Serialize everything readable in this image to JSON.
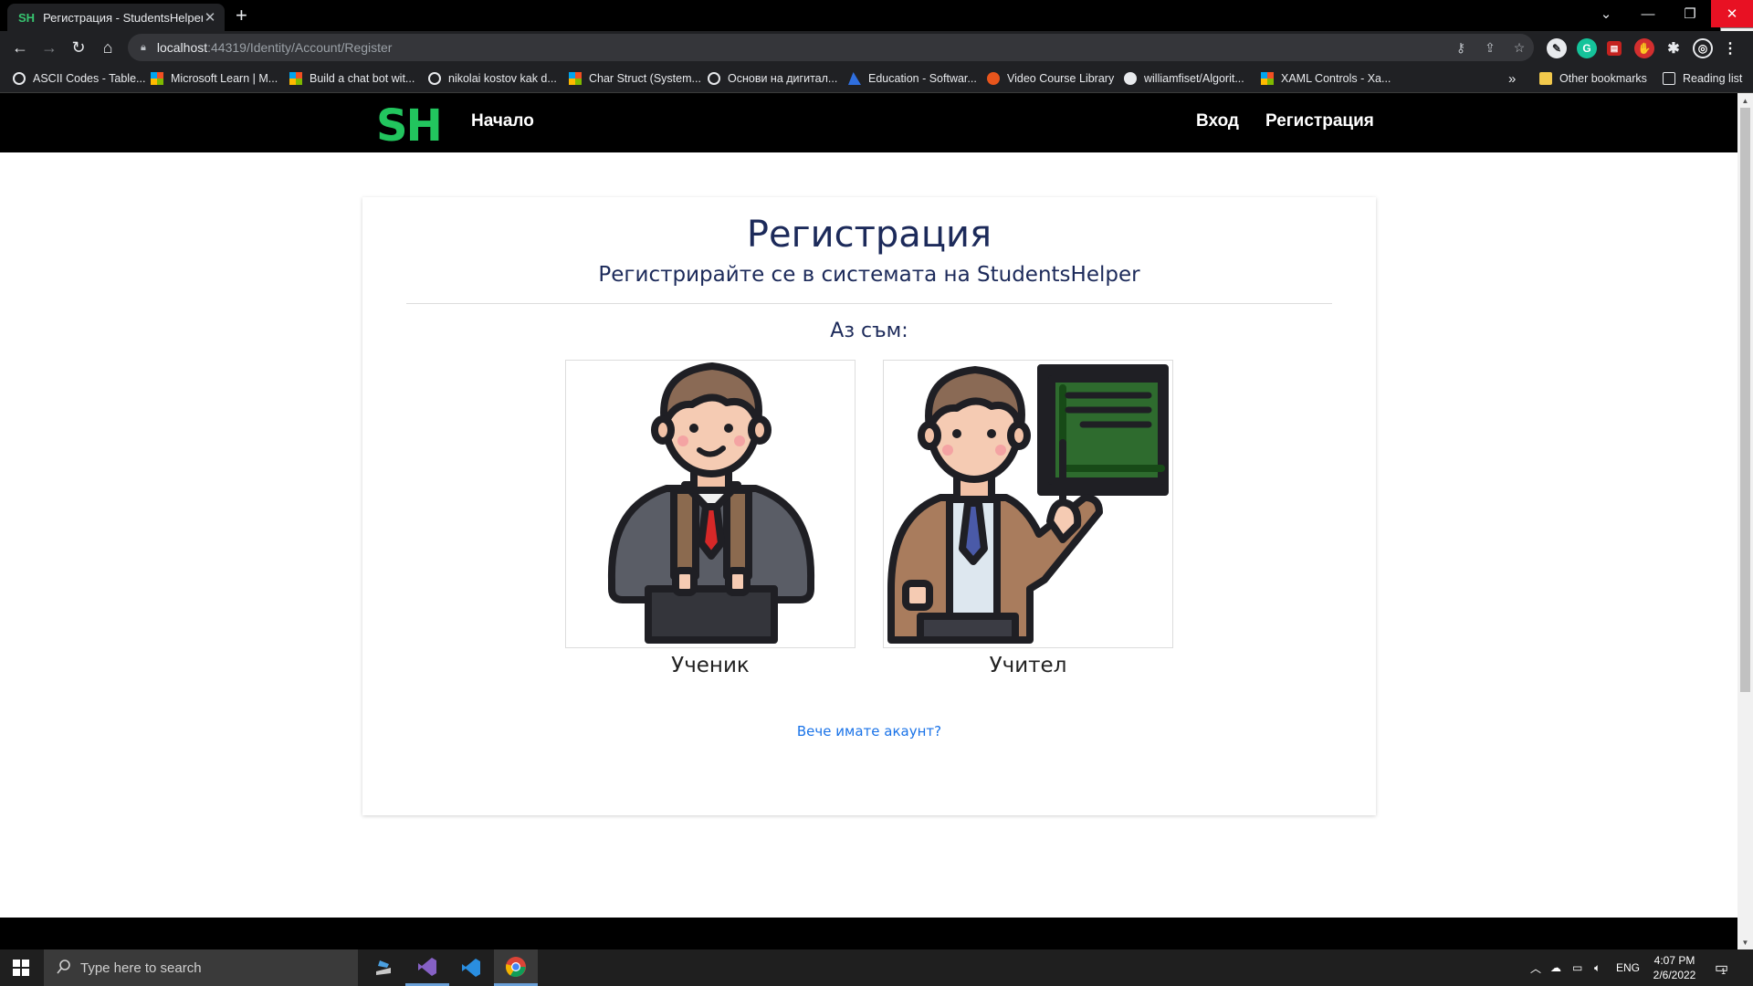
{
  "browser": {
    "tab_title": "Регистрация - StudentsHelper",
    "tab_favicon": "SH",
    "new_tab": "+",
    "close_tooltip": "Close",
    "url_host": "localhost",
    "url_path": ":44319/Identity/Account/Register",
    "bookmarks": [
      {
        "label": "ASCII Codes - Table...",
        "icon": "globe-icon"
      },
      {
        "label": "Microsoft Learn | M...",
        "icon": "microsoft-icon"
      },
      {
        "label": "Build a chat bot wit...",
        "icon": "microsoft-icon"
      },
      {
        "label": "nikolai kostov kak d...",
        "icon": "google-icon"
      },
      {
        "label": "Char Struct (System...",
        "icon": "microsoft-icon"
      },
      {
        "label": "Основи на дигитал...",
        "icon": "google-icon"
      },
      {
        "label": "Education - Softwar...",
        "icon": "azure-icon"
      },
      {
        "label": "Video Course Library",
        "icon": "play-icon"
      },
      {
        "label": "williamfiset/Algorit...",
        "icon": "github-icon"
      },
      {
        "label": "XAML Controls - Xa...",
        "icon": "microsoft-icon"
      }
    ],
    "bookmarks_more": "»",
    "other_bookmarks": "Other bookmarks",
    "reading_list": "Reading list"
  },
  "site": {
    "logo": "SH",
    "nav_home": "Начало",
    "nav_login": "Вход",
    "nav_register": "Регистрация",
    "accent_color": "#22c55e"
  },
  "register": {
    "title": "Регистрация",
    "subtitle": "Регистрирайте се в системата на StudentsHelper",
    "iam": "Аз съм:",
    "roles": [
      {
        "label": "Ученик",
        "icon": "student-illustration"
      },
      {
        "label": "Учител",
        "icon": "teacher-illustration"
      }
    ],
    "login_link": "Вече имате акаунт?"
  },
  "taskbar": {
    "search_placeholder": "Type here to search",
    "language": "ENG",
    "time": "4:07 PM",
    "date": "2/6/2022",
    "notification_count": "1"
  }
}
